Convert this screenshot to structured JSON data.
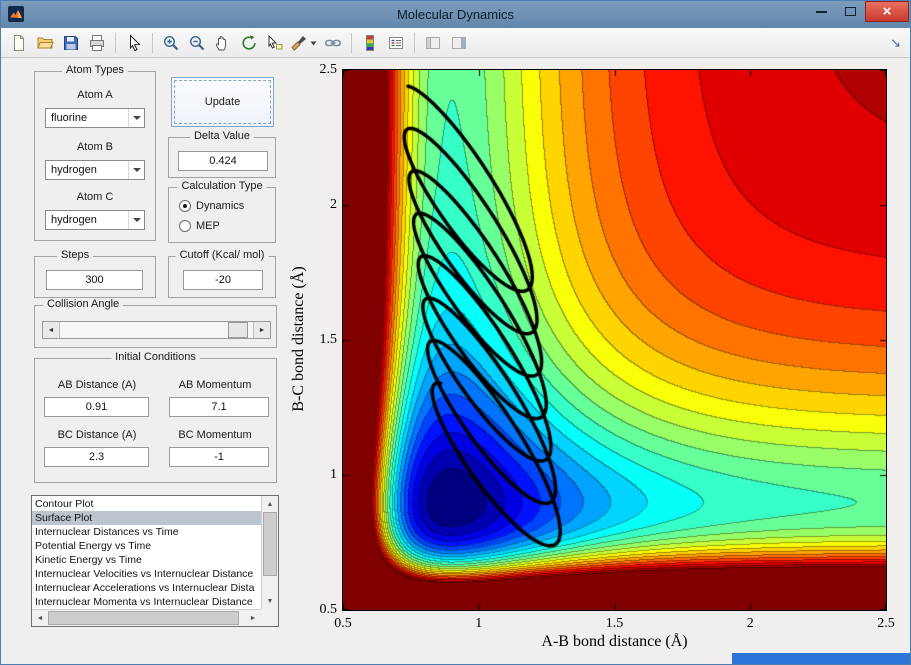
{
  "window": {
    "title": "Molecular Dynamics"
  },
  "glyphs": {
    "close": "×",
    "dock": "↘",
    "arrow_up": "▲",
    "arrow_down": "▼",
    "arrow_left": "◄",
    "arrow_right": "►"
  },
  "toolbar": {
    "icons": [
      "new-file",
      "open-folder",
      "save",
      "print",
      "edit-pointer",
      "zoom-in",
      "zoom-out",
      "pan-hand",
      "rotate-3d",
      "data-cursor",
      "brush",
      "link-plots",
      "insert-colorbar",
      "insert-legend",
      "hide-plot-tools",
      "show-plot-tools",
      "dock-figure"
    ]
  },
  "controls": {
    "atom_types": {
      "title": "Atom Types",
      "atom_a_label": "Atom A",
      "atom_a_value": "fluorine",
      "atom_b_label": "Atom B",
      "atom_b_value": "hydrogen",
      "atom_c_label": "Atom C",
      "atom_c_value": "hydrogen"
    },
    "update_button_label": "Update",
    "delta": {
      "title": "Delta Value",
      "value": "0.424"
    },
    "calc_type": {
      "title": "Calculation Type",
      "options": [
        {
          "label": "Dynamics",
          "selected": true
        },
        {
          "label": "MEP",
          "selected": false
        }
      ]
    },
    "steps": {
      "title": "Steps",
      "value": "300"
    },
    "cutoff": {
      "title": "Cutoff (Kcal/ mol)",
      "value": "-20"
    },
    "collision_angle": {
      "title": "Collision Angle",
      "thumb_fraction": 0.97
    },
    "initial_conditions": {
      "title": "Initial Conditions",
      "ab_distance_label": "AB Distance (A)",
      "ab_distance_value": "0.91",
      "ab_momentum_label": "AB Momentum",
      "ab_momentum_value": "7.1",
      "bc_distance_label": "BC Distance (A)",
      "bc_distance_value": "2.3",
      "bc_momentum_label": "BC Momentum",
      "bc_momentum_value": "-1"
    },
    "plot_list": {
      "items": [
        "Contour Plot",
        "Surface Plot",
        "Internuclear Distances vs Time",
        "Potential Energy vs Time",
        "Kinetic Energy vs Time",
        "Internuclear Velocities vs Internuclear Distance",
        "Internuclear Accelerations vs Internuclear Dista",
        "Internuclear Momenta vs Internuclear Distance"
      ],
      "selected_index": 1
    }
  },
  "chart_data": {
    "type": "heatmap",
    "subtype": "filled-contour potential energy surface with dynamics trajectory",
    "title": "",
    "xlabel": "A-B bond distance (Å)",
    "ylabel": "B-C bond distance (Å)",
    "xlim": [
      0.5,
      2.5
    ],
    "ylim": [
      0.5,
      2.5
    ],
    "xticks": [
      0.5,
      1,
      1.5,
      2,
      2.5
    ],
    "yticks": [
      0.5,
      1,
      1.5,
      2,
      2.5
    ],
    "xtick_labels": [
      "0.5",
      "1",
      "1.5",
      "2",
      "2.5"
    ],
    "ytick_labels": [
      "0.5",
      "1",
      "1.5",
      "2",
      "2.5"
    ],
    "grid": false,
    "legend": false,
    "colormap": "jet",
    "contour_levels": 22,
    "surface_model": {
      "type": "sum_of_morse",
      "D": 1,
      "a": 3.0,
      "re": 0.9,
      "v_min": -2,
      "v_max_clip": 0.15
    },
    "trajectory": {
      "color": "#000000",
      "line_width": 3.5,
      "loops": 7,
      "x_center": 0.95,
      "x_drift": 0.12,
      "x_amplitude": 0.24,
      "y_amplitude": 0.34,
      "phase": 0.5,
      "y_start": 2.1,
      "y_end": 1.0
    }
  }
}
